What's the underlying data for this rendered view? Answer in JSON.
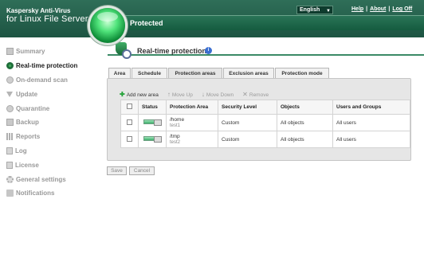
{
  "header": {
    "brand_line1": "Kaspersky Anti-Virus",
    "brand_line2": "for Linux File Server",
    "language": "English",
    "links": {
      "help": "Help",
      "about": "About",
      "logout": "Log Off"
    },
    "status": "Protected"
  },
  "sidebar": {
    "items": [
      {
        "label": "Summary",
        "icon": "summary-icon"
      },
      {
        "label": "Real-time protection",
        "icon": "shield-icon",
        "active": true
      },
      {
        "label": "On-demand scan",
        "icon": "scan-icon"
      },
      {
        "label": "Update",
        "icon": "update-icon"
      },
      {
        "label": "Quarantine",
        "icon": "quarantine-icon"
      },
      {
        "label": "Backup",
        "icon": "backup-icon"
      },
      {
        "label": "Reports",
        "icon": "reports-icon"
      },
      {
        "label": "Log",
        "icon": "log-icon"
      },
      {
        "label": "License",
        "icon": "license-icon"
      },
      {
        "label": "General settings",
        "icon": "settings-icon"
      },
      {
        "label": "Notifications",
        "icon": "notifications-icon"
      }
    ]
  },
  "main": {
    "title": "Real-time protection",
    "tabs": [
      "Area",
      "Schedule",
      "Protection areas",
      "Exclusion areas",
      "Protection mode"
    ],
    "active_tab": "Protection areas",
    "toolbar": {
      "add": "Add new area",
      "move_up": "Move Up",
      "move_down": "Move Down",
      "remove": "Remove"
    },
    "table": {
      "headers": [
        "Status",
        "Protection Area",
        "Security Level",
        "Objects",
        "Users and Groups"
      ],
      "rows": [
        {
          "path": "/home",
          "name": "test1",
          "level": "Custom",
          "objects": "All objects",
          "users": "All users"
        },
        {
          "path": "/tmp",
          "name": "test2",
          "level": "Custom",
          "objects": "All objects",
          "users": "All users"
        }
      ]
    },
    "buttons": {
      "save": "Save",
      "cancel": "Cancel"
    }
  },
  "colors": {
    "header_bg": "#1d5442",
    "accent": "#3b8a66",
    "status_green": "#3caf6a"
  }
}
